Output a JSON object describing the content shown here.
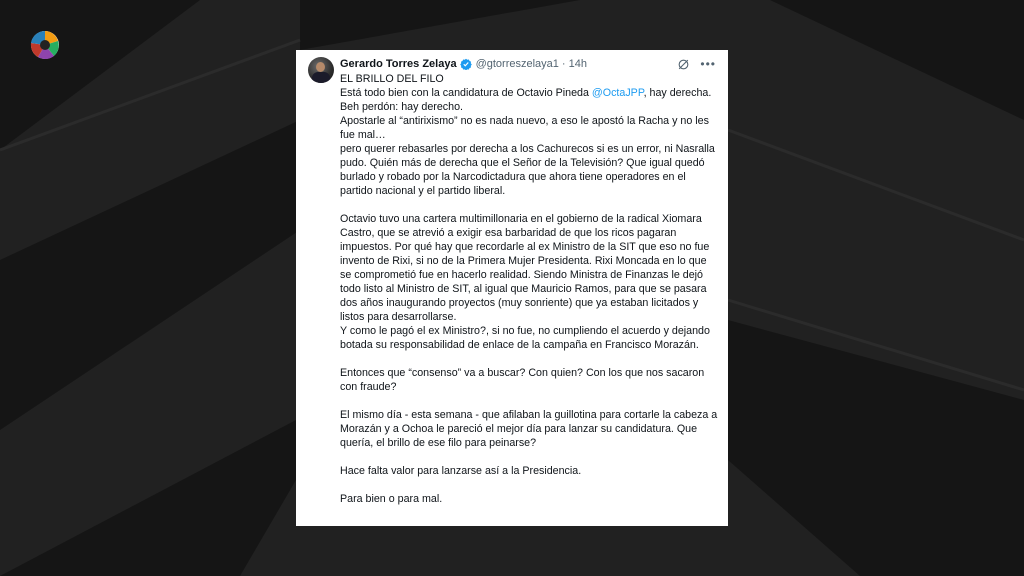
{
  "tweet": {
    "author_name": "Gerardo Torres Zelaya",
    "handle": "@gtorreszelaya1",
    "separator": "·",
    "time": "14h",
    "title": "EL BRILLO DEL FILO",
    "p1_line1_before": "Está todo bien con la candidatura de Octavio Pineda ",
    "mention": "@OctaJPP",
    "p1_line1_after": ", hay derecha. Beh perdón: hay derecho.",
    "p1_line2": "Apostarle al “antirixismo” no es nada nuevo, a eso le apostó la Racha y no les fue mal…",
    "p1_line3": "pero querer rebasarles por derecha a los Cachurecos si es un error, ni Nasralla pudo. Quién más de derecha que el Señor de la Televisión? Que igual quedó burlado y robado por la Narcodictadura que ahora tiene operadores en el partido nacional y el partido liberal.",
    "p2": "Octavio tuvo una cartera multimillonaria en el gobierno de la radical Xiomara Castro, que se atrevió a exigir esa barbaridad de que los ricos pagaran impuestos. Por qué hay que recordarle al ex Ministro de la SIT que eso no fue invento de Rixi, si no de la Primera Mujer Presidenta. Rixi Moncada en lo que se comprometió fue en hacerlo realidad. Siendo Ministra de Finanzas le dejó todo listo al Ministro de SIT, al igual que Mauricio Ramos, para que se pasara dos años inaugurando proyectos (muy sonriente) que ya estaban licitados y listos para desarrollarse.",
    "p3": "Y como le pagó el ex Ministro?, si no fue, no cumpliendo el acuerdo y dejando botada su responsabilidad de enlace de la campaña en Francisco Morazán.",
    "p4": "Entonces que “consenso” va a buscar? Con quien? Con los que nos sacaron con fraude?",
    "p5": "El mismo día - esta semana - que afilaban la guillotina para cortarle la cabeza a Morazán y a Ochoa le pareció el mejor día para lanzar su candidatura. Que quería, el brillo de ese filo para peinarse?",
    "p6": "Hace falta valor para lanzarse así a la Presidencia.",
    "p7": "Para bien o para mal."
  },
  "icons": {
    "logo": "channel-logo-icon",
    "verified": "verified-badge-icon",
    "grok": "grok-icon",
    "more": "more-icon"
  },
  "colors": {
    "background": "#202020",
    "aperture": "#161616",
    "card": "#ffffff",
    "link": "#1d9bf0",
    "verified": "#1d9bf0",
    "secondary_text": "#536471"
  }
}
